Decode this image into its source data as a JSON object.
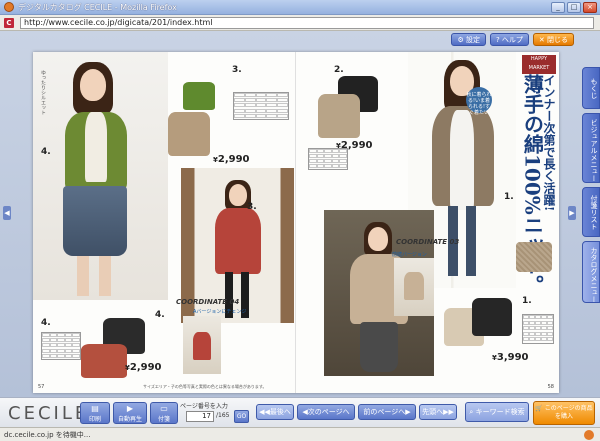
{
  "window": {
    "title": "デジタルカタログ CECILE - Mozilla Firefox",
    "min": "_",
    "max": "□",
    "close": "×"
  },
  "address": {
    "url": "http://www.cecile.co.jp/digicata/201/index.html",
    "site_icon": "C"
  },
  "toolbar_top": {
    "settings": "設定",
    "help": "ヘルプ",
    "close": "閉じる"
  },
  "side_tabs": [
    "もくじ",
    "ビジュアルメニュー",
    "付箋リスト",
    "カタログメニュー"
  ],
  "nav": {
    "prev": "◀",
    "next": "▶"
  },
  "catalog": {
    "left": {
      "item_numbers": [
        "4.",
        "3.",
        "3.",
        "4.",
        "4."
      ],
      "prices": [
        "2,990",
        "2,990"
      ],
      "yen": "¥",
      "coordinate": "COORDINATE 04",
      "coord_label": "Aバージョンにチェンジ",
      "page_number": "57",
      "footnote": "サイズエリア・子の色等写真と実際の色とは異なる場合があります。"
    },
    "right": {
      "happy_market": "HAPPY MARKET",
      "headline_1": "インナー次第で長く活躍!",
      "headline_2": "薄手の綿100%ニット。",
      "badge": "秋に着られる!いま着られる!すぐ着たい",
      "coordinate": "COORDINATE 03",
      "coord_label": "前続バージョン",
      "item_numbers": [
        "2.",
        "1.",
        "1."
      ],
      "prices": [
        "2,990",
        "3,990"
      ],
      "page_number": "58"
    }
  },
  "bottom": {
    "logo": "CECILE",
    "print": "印刷",
    "auto_play": "自動再生",
    "sticky": "付箋",
    "page_input_label": "ページ番号を入力",
    "page_value": "17",
    "page_total": "/165",
    "go": "GO",
    "first": "最後へ",
    "next_page": "次のページへ",
    "prev_page": "前のページへ",
    "first_page": "先頭へ",
    "keyword_search": "キーワード検索",
    "buy": "このページの商品を購入"
  },
  "status": {
    "text": "dc.cecile.co.jp を待機中..."
  }
}
